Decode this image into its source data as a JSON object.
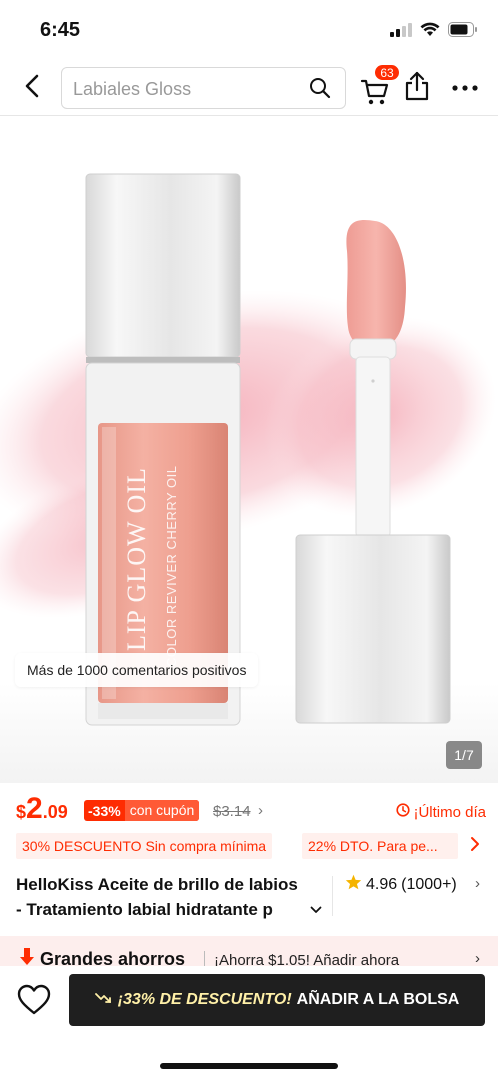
{
  "status": {
    "time": "6:45"
  },
  "nav": {
    "search_placeholder": "Labiales Gloss",
    "cart_count": "63"
  },
  "gallery": {
    "review_pill": "Más de 1000 comentarios positivos",
    "page_indicator": "1/7",
    "product_label_text": "LIP GLOW OIL",
    "product_sub_text": "COLOR REVIVER CHERRY OIL"
  },
  "price": {
    "currency": "$",
    "integer": "2",
    "decimal": ".09",
    "discount_pct": "-33%",
    "coupon": "con cupón",
    "original": "$3.14",
    "last_day": "¡Último día"
  },
  "promos": [
    {
      "text": "30% DESCUENTO Sin compra mínima"
    },
    {
      "text": "22% DTO. Para pe..."
    }
  ],
  "product": {
    "title_line1": "HelloKiss Aceite de brillo de labios",
    "title_line2": "- Tratamiento labial hidratante p",
    "rating": "4.96",
    "rating_count": "(1000+)"
  },
  "savings": {
    "title": "Grandes ahorros",
    "text": "¡Ahorra $1.05! Añadir ahora"
  },
  "action": {
    "discount_text": "¡33% DE DESCUENTO!",
    "add_label": "AÑADIR A LA BOLSA"
  },
  "colors": {
    "accent": "#fe2c02",
    "dark_button": "#1f1f1f",
    "promo_bg": "#fff0ed",
    "savings_bg": "#fdeeed"
  }
}
